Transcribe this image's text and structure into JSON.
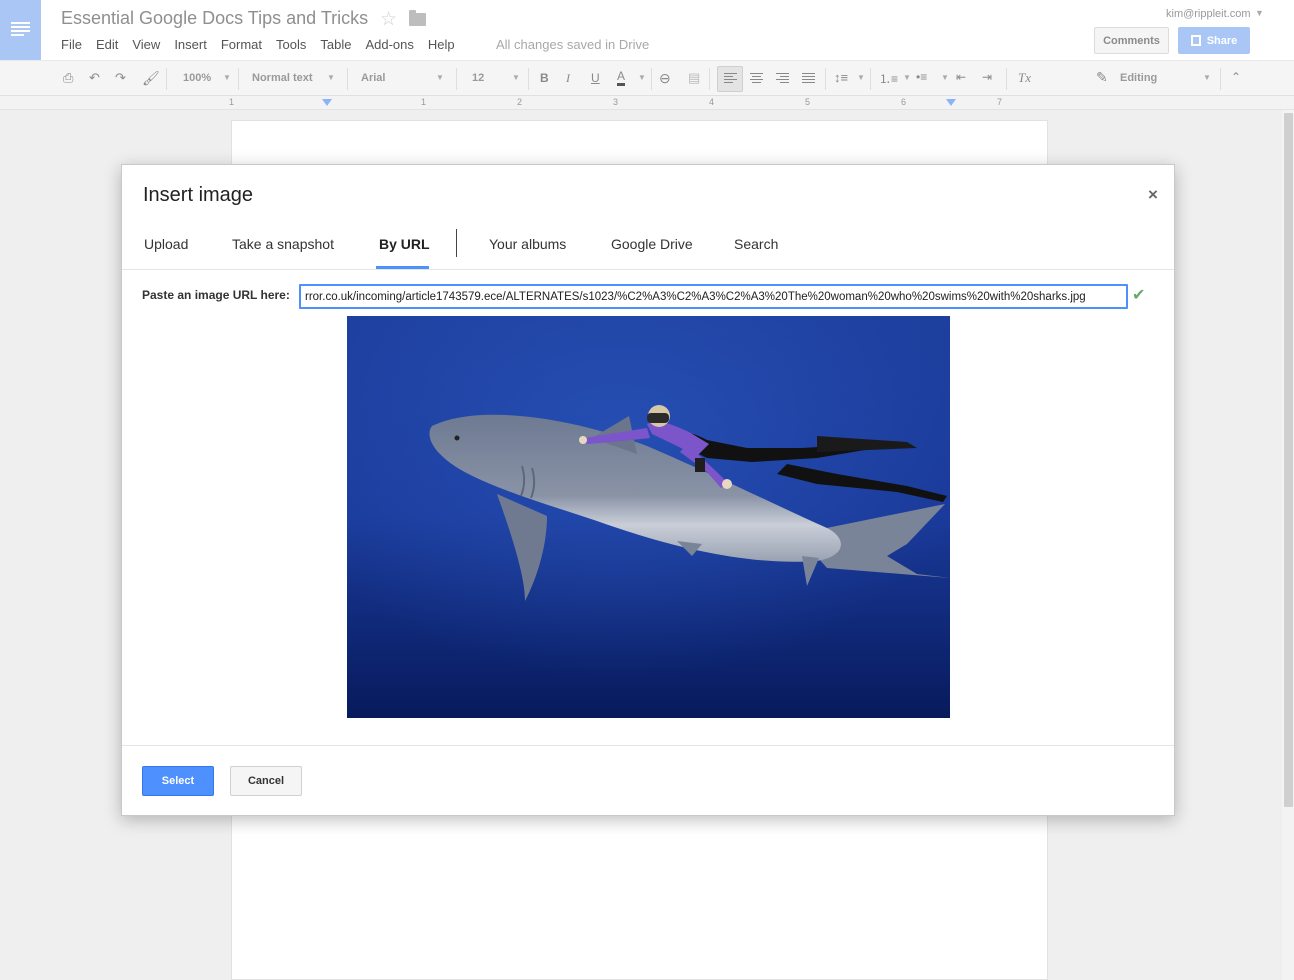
{
  "header": {
    "doc_title": "Essential Google Docs Tips and Tricks",
    "menu": [
      "File",
      "Edit",
      "View",
      "Insert",
      "Format",
      "Tools",
      "Table",
      "Add-ons",
      "Help"
    ],
    "save_status": "All changes saved in Drive",
    "account": "kim@rippleit.com",
    "comments_label": "Comments",
    "share_label": "Share"
  },
  "toolbar": {
    "zoom": "100%",
    "style": "Normal text",
    "font": "Arial",
    "size": "12",
    "bold": "B",
    "italic": "I",
    "underline": "U",
    "text_color": "A",
    "mode": "Editing",
    "clear_format": "Tx"
  },
  "ruler": {
    "numbers": [
      "1",
      "1",
      "2",
      "3",
      "4",
      "5",
      "6",
      "7"
    ]
  },
  "dialog": {
    "title": "Insert image",
    "close": "×",
    "tabs": {
      "upload": "Upload",
      "snapshot": "Take a snapshot",
      "by_url": "By URL",
      "albums": "Your albums",
      "drive": "Google Drive",
      "search": "Search"
    },
    "url_label": "Paste an image URL here:",
    "url_value": "rror.co.uk/incoming/article1743579.ece/ALTERNATES/s1023/%C2%A3%C2%A3%C2%A3%20The%20woman%20who%20swims%20with%20sharks.jpg",
    "select_label": "Select",
    "cancel_label": "Cancel"
  },
  "colors": {
    "accent": "#4d90fe",
    "share_disabled": "#a9c6f5"
  }
}
